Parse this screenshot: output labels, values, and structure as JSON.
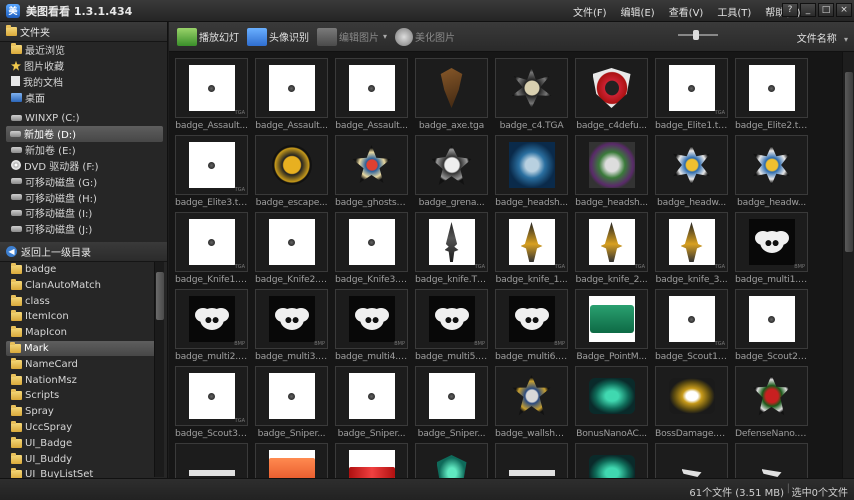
{
  "app": {
    "title": "美图看看 1.3.1.434",
    "icon_name": "app-logo-icon"
  },
  "menu": [
    "文件(F)",
    "编辑(E)",
    "查看(V)",
    "工具(T)",
    "帮助(H)"
  ],
  "window_controls": [
    "?",
    "_",
    "□",
    "×"
  ],
  "sidebar": {
    "header": "文件夹",
    "places": [
      {
        "label": "最近浏览",
        "icon": "folder-icon"
      },
      {
        "label": "图片收藏",
        "icon": "star-icon"
      },
      {
        "label": "我的文档",
        "icon": "document-icon"
      },
      {
        "label": "桌面",
        "icon": "desktop-icon"
      }
    ],
    "drives": [
      {
        "label": "WINXP (C:)",
        "icon": "drive-icon"
      },
      {
        "label": "新加卷 (D:)",
        "icon": "drive-icon",
        "selected": true
      },
      {
        "label": "新加卷 (E:)",
        "icon": "drive-icon"
      },
      {
        "label": "DVD 驱动器 (F:)",
        "icon": "dvd-icon"
      },
      {
        "label": "可移动磁盘 (G:)",
        "icon": "drive-icon"
      },
      {
        "label": "可移动磁盘 (H:)",
        "icon": "drive-icon"
      },
      {
        "label": "可移动磁盘 (I:)",
        "icon": "drive-icon"
      },
      {
        "label": "可移动磁盘 (J:)",
        "icon": "drive-icon"
      }
    ],
    "up_label": "返回上一级目录",
    "folders": [
      {
        "label": "badge"
      },
      {
        "label": "ClanAutoMatch"
      },
      {
        "label": "class"
      },
      {
        "label": "ItemIcon"
      },
      {
        "label": "MapIcon"
      },
      {
        "label": "Mark",
        "selected": true
      },
      {
        "label": "NameCard"
      },
      {
        "label": "NationMsz"
      },
      {
        "label": "Scripts"
      },
      {
        "label": "Spray"
      },
      {
        "label": "UccSpray"
      },
      {
        "label": "UI_Badge"
      },
      {
        "label": "UI_Buddy"
      },
      {
        "label": "UI_BuyListSet"
      }
    ]
  },
  "toolbar": {
    "slideshow": "播放幻灯",
    "face_detect": "头像识别",
    "edit_image": "编辑图片",
    "beautify": "美化图片",
    "sort_label": "文件名称",
    "zoom_level": 0.45
  },
  "files": [
    {
      "name": "badge_Assault...",
      "art": "dot",
      "ext": "TGA"
    },
    {
      "name": "badge_Assault...",
      "art": "dot",
      "ext": ""
    },
    {
      "name": "badge_Assault...",
      "art": "dot",
      "ext": ""
    },
    {
      "name": "badge_axe.tga",
      "art": "axe",
      "ext": ""
    },
    {
      "name": "badge_c4.TGA",
      "art": "star",
      "ext": ""
    },
    {
      "name": "badge_c4defu...",
      "art": "shield",
      "ext": ""
    },
    {
      "name": "badge_Elite1.tga",
      "art": "dot",
      "ext": "TGA"
    },
    {
      "name": "badge_Elite2.tga",
      "art": "dot",
      "ext": ""
    },
    {
      "name": "badge_Elite3.tga",
      "art": "dot",
      "ext": "TGA"
    },
    {
      "name": "badge_escape...",
      "art": "round",
      "ext": ""
    },
    {
      "name": "badge_ghostsh...",
      "art": "ghost",
      "ext": ""
    },
    {
      "name": "badge_grena...",
      "art": "grenade",
      "ext": ""
    },
    {
      "name": "badge_headsh...",
      "art": "skull",
      "ext": ""
    },
    {
      "name": "badge_headsh...",
      "art": "skull2",
      "ext": ""
    },
    {
      "name": "badge_headw...",
      "art": "lock",
      "ext": ""
    },
    {
      "name": "badge_headw...",
      "art": "lock",
      "ext": ""
    },
    {
      "name": "badge_Knife1.tga",
      "art": "dot",
      "ext": "TGA"
    },
    {
      "name": "badge_Knife2.tga",
      "art": "dot",
      "ext": ""
    },
    {
      "name": "badge_Knife3.tga",
      "art": "dot",
      "ext": ""
    },
    {
      "name": "badge_knife.TGA",
      "art": "knife",
      "ext": "TGA"
    },
    {
      "name": "badge_knife_1...",
      "art": "knife-g",
      "ext": "TGA"
    },
    {
      "name": "badge_knife_2...",
      "art": "knife-g",
      "ext": "TGA"
    },
    {
      "name": "badge_knife_3...",
      "art": "knife-g",
      "ext": "TGA"
    },
    {
      "name": "badge_multi1.tga",
      "art": "panda",
      "ext": "BMP"
    },
    {
      "name": "badge_multi2.tga",
      "art": "panda",
      "ext": "BMP"
    },
    {
      "name": "badge_multi3.tga",
      "art": "panda",
      "ext": "BMP"
    },
    {
      "name": "badge_multi4.tga",
      "art": "panda",
      "ext": "BMP"
    },
    {
      "name": "badge_multi5.tga",
      "art": "panda",
      "ext": "BMP"
    },
    {
      "name": "badge_multi6.tga",
      "art": "panda",
      "ext": "BMP"
    },
    {
      "name": "Badge_PointM...",
      "art": "point",
      "ext": ""
    },
    {
      "name": "badge_Scout1....",
      "art": "dot",
      "ext": "TGA"
    },
    {
      "name": "badge_Scout2....",
      "art": "dot",
      "ext": ""
    },
    {
      "name": "badge_Scout3....",
      "art": "dot",
      "ext": "TGA"
    },
    {
      "name": "badge_Sniper...",
      "art": "dot",
      "ext": ""
    },
    {
      "name": "badge_Sniper...",
      "art": "dot",
      "ext": ""
    },
    {
      "name": "badge_Sniper...",
      "art": "dot",
      "ext": ""
    },
    {
      "name": "badge_wallsho...",
      "art": "wall",
      "ext": ""
    },
    {
      "name": "BonusNanoAC...",
      "art": "bonus",
      "ext": ""
    },
    {
      "name": "BossDamage.tga",
      "art": "boss",
      "ext": ""
    },
    {
      "name": "DefenseNano.tga",
      "art": "def",
      "ext": ""
    },
    {
      "name": "",
      "art": "strip",
      "ext": ""
    },
    {
      "name": "",
      "art": "orange",
      "ext": ""
    },
    {
      "name": "",
      "art": "red-banner",
      "ext": ""
    },
    {
      "name": "",
      "art": "teal",
      "ext": ""
    },
    {
      "name": "",
      "art": "strip",
      "ext": ""
    },
    {
      "name": "",
      "art": "bonus",
      "ext": ""
    },
    {
      "name": "",
      "art": "wing",
      "ext": ""
    },
    {
      "name": "",
      "art": "wing",
      "ext": ""
    }
  ],
  "status": {
    "count": "61个文件 (3.51 MB)",
    "selected": "选中0个文件"
  }
}
